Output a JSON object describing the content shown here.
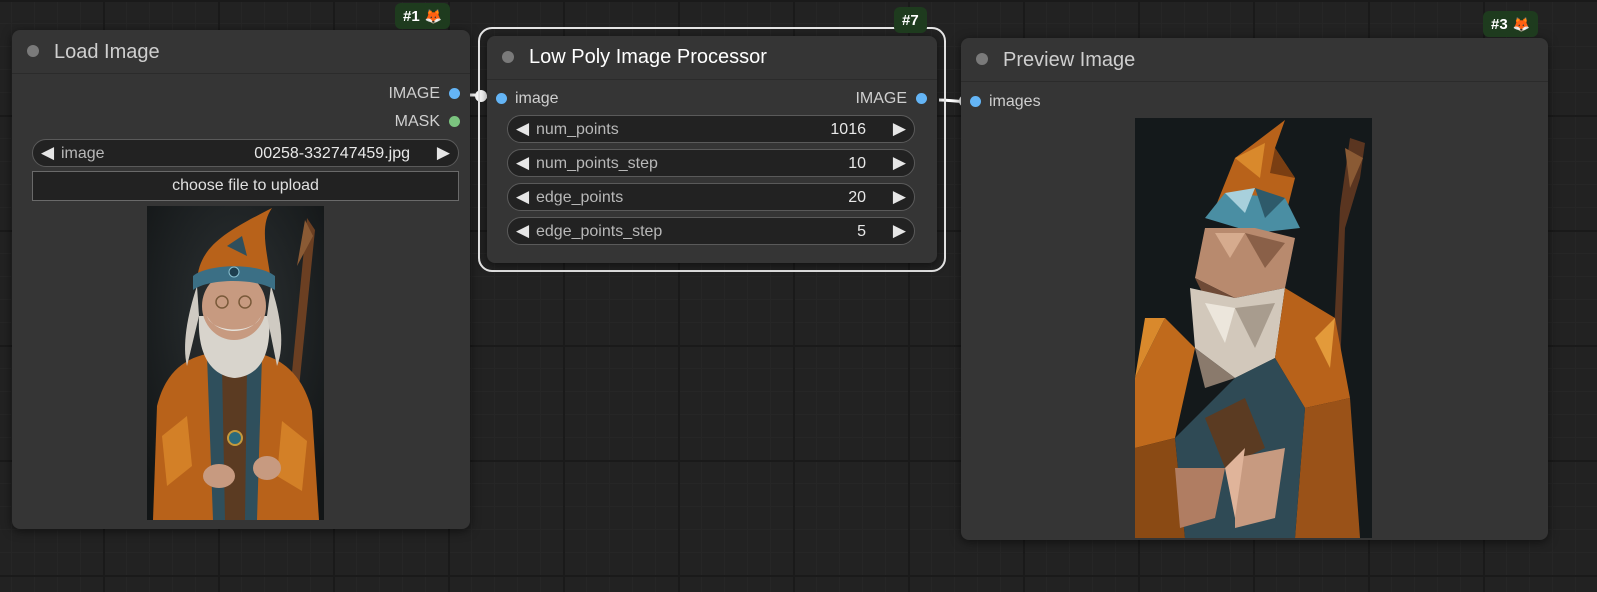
{
  "canvas": {
    "background": "#222222"
  },
  "nodes": {
    "load_image": {
      "title": "Load Image",
      "badge": "#1",
      "outputs": [
        "IMAGE",
        "MASK"
      ],
      "widget": {
        "label": "image",
        "value": "00258-332747459.jpg"
      },
      "upload_label": "choose file to upload",
      "preview_icon": "wizard-portrait-image"
    },
    "low_poly": {
      "title": "Low Poly Image Processor",
      "badge": "#7",
      "input": "image",
      "output": "IMAGE",
      "widgets": [
        {
          "label": "num_points",
          "value": "1016"
        },
        {
          "label": "num_points_step",
          "value": "10"
        },
        {
          "label": "edge_points",
          "value": "20"
        },
        {
          "label": "edge_points_step",
          "value": "5"
        }
      ]
    },
    "preview_image": {
      "title": "Preview Image",
      "badge": "#3",
      "input": "images",
      "preview_icon": "low-poly-wizard-image"
    }
  },
  "colors": {
    "image_slot": "#64b5f6",
    "mask_slot": "#7bc47f",
    "badge_bg": "#1e3b1e",
    "selected_outline": "#e6e6e6",
    "wire": "#ffffff"
  }
}
